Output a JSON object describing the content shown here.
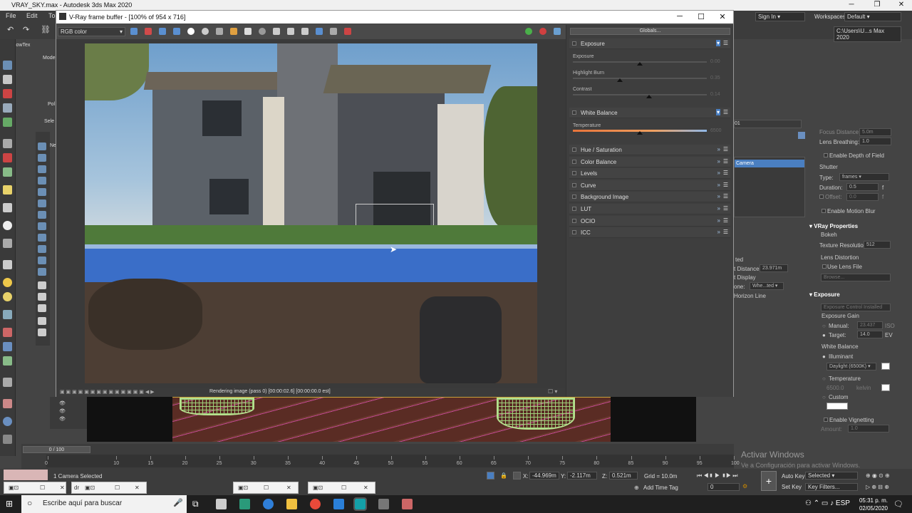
{
  "max_window": {
    "title": "VRAY_SKY.max - Autodesk 3ds Max 2020",
    "menu": [
      "File",
      "Edit",
      "To"
    ],
    "toolbar_labels": [
      "ShowTex",
      "Modelin",
      "Pol",
      "Sele",
      "Ne"
    ]
  },
  "right_top": {
    "sign_in": "Sign In",
    "workspaces_label": "Workspaces:",
    "workspaces_value": "Default",
    "path": "C:\\Users\\U...s Max 2020"
  },
  "camera_list_item": "Camera",
  "camera_name_suffix": "01",
  "physical_camera": {
    "focus_distance_label": "Focus Distance:",
    "focus_distance_value": "5.0m",
    "lens_breathing_label": "Lens Breathing:",
    "lens_breathing_value": "1.0",
    "enable_dof": "Enable Depth of Field",
    "shutter_head": "Shutter",
    "type_label": "Type:",
    "type_value": "frames",
    "duration_label": "Duration:",
    "duration_value": "0.5",
    "duration_unit": "f",
    "offset_label": "Offset:",
    "offset_value": "0.0",
    "offset_unit": "f",
    "enable_motion_blur": "Enable Motion Blur",
    "vray_props_head": "VRay Properties",
    "bokeh": "Bokeh",
    "texture_res_label": "Texture Resolution",
    "texture_res_value": "512",
    "lens_distortion": "Lens Distortion",
    "use_lens_file": "Use Lens File",
    "browse": "Browse...",
    "exposure_head": "Exposure",
    "exposure_control": "Exposure Control Installed",
    "exposure_gain": "Exposure Gain",
    "manual_label": "Manual:",
    "manual_value": "23.437",
    "manual_unit": "ISO",
    "target_label": "Target:",
    "target_value": "14.0",
    "target_unit": "EV",
    "white_balance": "White Balance",
    "illuminant": "Illuminant",
    "illuminant_value": "Daylight (6500K)",
    "temperature": "Temperature",
    "temperature_value": "6500.0",
    "temperature_unit": "kelvin",
    "custom": "Custom",
    "enable_vignetting": "Enable Vignetting",
    "amount_label": "Amount:",
    "amount_value": "1.0"
  },
  "left_panel_fragments": {
    "ted": "ted",
    "distance_label": "t Distance:",
    "distance_value": "23.971m",
    "display": "t Display",
    "one_label": "one:",
    "one_value": "Whe...ted",
    "horizon": "Horizon Line"
  },
  "vfb": {
    "title": "V-Ray frame buffer - [100% of 954 x 716]",
    "channel": "RGB color",
    "globals": "Globals...",
    "status": "Rendering image (pass 0) [00:00:02.6] [00:00:00.0 est]",
    "exposure_section": "Exposure",
    "exposure_label": "Exposure",
    "exposure_value": "0.00",
    "highlight_burn_label": "Highlight Burn",
    "highlight_burn_value": "0.35",
    "contrast_label": "Contrast",
    "contrast_value": "0.14",
    "white_balance_section": "White Balance",
    "temperature_label": "Temperature",
    "temperature_value": "6500",
    "sections": [
      "Hue / Saturation",
      "Color Balance",
      "Levels",
      "Curve",
      "Background Image",
      "LUT",
      "OCIO",
      "ICC"
    ],
    "exposure_fraction": 0.5,
    "highlight_burn_fraction": 0.35,
    "contrast_fraction": 0.57,
    "temperature_fraction": 0.5
  },
  "timeline": {
    "slider_label": "0 / 100",
    "ticks": [
      "0",
      "10",
      "15",
      "20",
      "25",
      "30",
      "35",
      "40",
      "45",
      "50",
      "55",
      "60",
      "65",
      "70",
      "75",
      "80",
      "85",
      "90",
      "95",
      "100"
    ]
  },
  "status": {
    "selection": "1 Camera Selected",
    "x_label": "X:",
    "x_value": "-44.969m",
    "y_label": "Y:",
    "y_value": "-2.117m",
    "z_label": "Z:",
    "z_value": "0.521m",
    "grid": "Grid = 10.0m",
    "add_time_tag": "Add Time Tag",
    "auto_key": "Auto Key",
    "auto_key_value": "Selected",
    "set_key": "Set Key",
    "key_filters": "Key Filters...",
    "frame_value": "0",
    "mini_win_text": "dr"
  },
  "watermark": {
    "title": "Activar Windows",
    "sub": "Ve a Configuración para activar Windows."
  },
  "taskbar": {
    "search_placeholder": "Escribe aquí para buscar",
    "time": "05:31 p. m.",
    "date": "02/05/2020"
  },
  "colors": {
    "max_bg": "#444444",
    "accent_blue": "#4a7fc1",
    "temperature_bar": "#e87a3a"
  }
}
